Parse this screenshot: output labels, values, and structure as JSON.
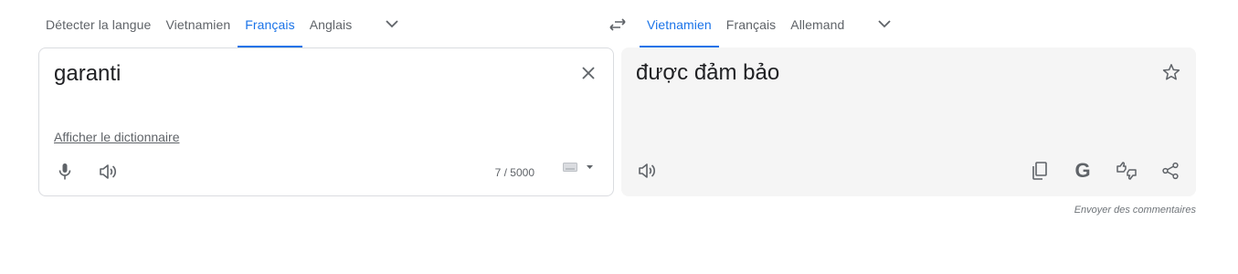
{
  "source_languages": {
    "tabs": [
      {
        "label": "Détecter la langue",
        "active": false
      },
      {
        "label": "Vietnamien",
        "active": false
      },
      {
        "label": "Français",
        "active": true
      },
      {
        "label": "Anglais",
        "active": false
      }
    ]
  },
  "target_languages": {
    "tabs": [
      {
        "label": "Vietnamien",
        "active": true
      },
      {
        "label": "Français",
        "active": false
      },
      {
        "label": "Allemand",
        "active": false
      }
    ]
  },
  "source": {
    "text": "garanti",
    "dictionary_link": "Afficher le dictionnaire",
    "char_count": "7 / 5000"
  },
  "target": {
    "text": "được đảm bảo",
    "google_icon_letter": "G"
  },
  "feedback_link": "Envoyer des commentaires",
  "icons": [
    "swap-languages-icon",
    "chevron-down-icon",
    "close-icon",
    "microphone-icon",
    "speaker-icon",
    "keyboard-icon",
    "caret-down-icon",
    "star-icon",
    "copy-icon",
    "google-icon",
    "rate-translation-icon",
    "share-icon"
  ],
  "colors": {
    "accent": "#1a73e8",
    "target_panel_bg": "#f5f5f5",
    "icon": "#5f6368"
  }
}
